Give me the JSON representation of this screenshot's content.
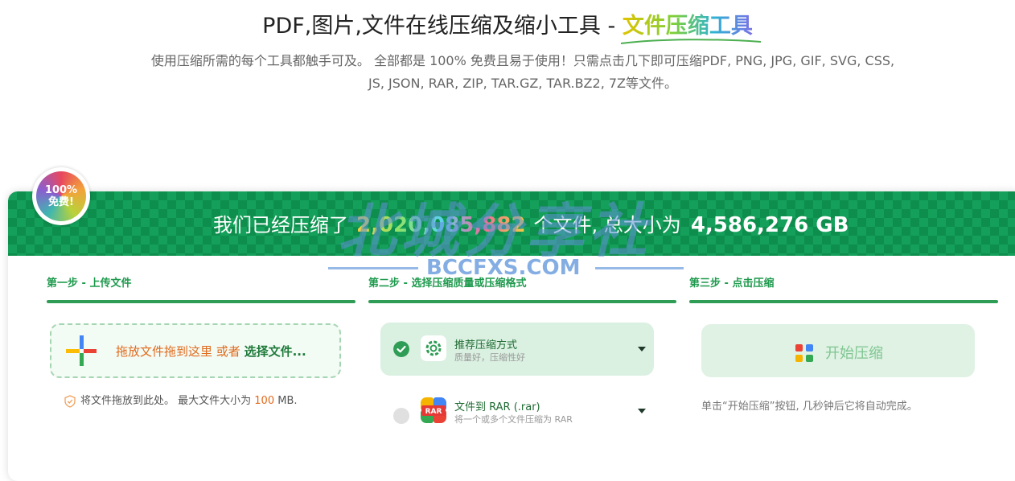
{
  "header": {
    "title_prefix": "PDF,图片,文件在线压缩及缩小工具 - ",
    "title_highlight": "文件压缩工具",
    "subtitle": "使用压缩所需的每个工具都触手可及。 全部都是 100% 免费且易于使用！只需点击几下即可压缩PDF, PNG, JPG, GIF, SVG, CSS, JS, JSON, RAR, ZIP, TAR.GZ, TAR.BZ2, 7Z等文件。"
  },
  "badge": {
    "line1": "100%",
    "line2": "免费!"
  },
  "banner": {
    "text1": "我们已经压缩了",
    "files_count": "2,020,085,882",
    "text2": "个文件, 总大小为",
    "total_size": "4,586,276 GB",
    "close_icon": "close-icon"
  },
  "watermark": {
    "text": "北城分享社",
    "url": "BCCFXS.COM"
  },
  "steps": {
    "step1": {
      "title": "第一步 - 上传文件",
      "drop_text": "拖放文件拖到这里 或者",
      "select_text": "选择文件...",
      "hint_prefix": "将文件拖放到此处。 最大文件大小为",
      "max_size": "100",
      "hint_unit": "MB."
    },
    "step2": {
      "title": "第二步 - 选择压缩质量或压缩格式",
      "options": [
        {
          "title": "推荐压缩方式",
          "subtitle": "质量好，压缩性好",
          "selected": true,
          "icon": "gear-icon"
        },
        {
          "title": "文件到 RAR (.rar)",
          "subtitle": "将一个或多个文件压缩为 RAR",
          "selected": false,
          "icon": "rar-icon"
        }
      ]
    },
    "step3": {
      "title": "第三步 - 点击压缩",
      "button_label": "开始压缩",
      "hint": "单击“开始压缩”按钮, 几秒钟后它将自动完成。"
    }
  },
  "colors": {
    "accent": "#2f9d55",
    "banner": "#14a05a",
    "warning": "#e06a1b"
  }
}
